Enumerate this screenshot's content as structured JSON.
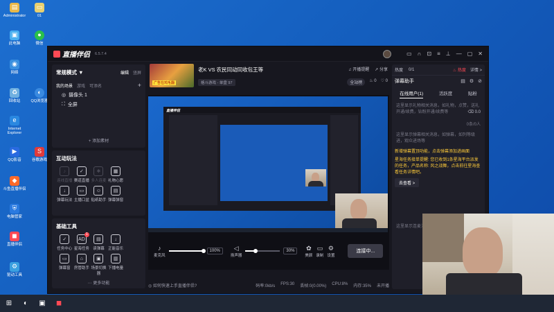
{
  "desktop": {
    "icons": [
      {
        "label": "Administrator",
        "icon": "user-folder-icon",
        "color": "#e8b84a"
      },
      {
        "label": "01",
        "icon": "folder-icon",
        "color": "#e8d070"
      },
      {
        "label": "此电脑",
        "icon": "computer-icon",
        "color": "#4ab0f0"
      },
      {
        "label": "微信",
        "icon": "wechat-icon",
        "color": "#2ac04a"
      },
      {
        "label": "网络",
        "icon": "network-icon",
        "color": "#3a90e0"
      },
      {
        "label": "回收站",
        "icon": "recycle-bin-icon",
        "color": "#70b0e0"
      },
      {
        "label": "QQ浏览器",
        "icon": "qq-browser-icon",
        "color": "#3a8ae0"
      },
      {
        "label": "Internet Explorer",
        "icon": "ie-icon",
        "color": "#2a88e0"
      },
      {
        "label": "QQ影音",
        "icon": "qq-player-icon",
        "color": "#2a6ae0"
      },
      {
        "label": "谷歌游戏",
        "icon": "game-icon",
        "color": "#e03a3a"
      },
      {
        "label": "斗鱼直播伴侣",
        "icon": "douyu-icon",
        "color": "#ff6a2a"
      },
      {
        "label": "电脑管家",
        "icon": "shield-icon",
        "color": "#2a7ae0"
      },
      {
        "label": "直播伴侣",
        "icon": "live-companion-icon",
        "color": "#ff4a55"
      },
      {
        "label": "驱动工具",
        "icon": "driver-tool-icon",
        "color": "#3aa0e0"
      }
    ]
  },
  "app": {
    "name": "直播伴侣",
    "version": "6.5.7.4",
    "titlebar_icons": [
      "chat-icon",
      "headset-icon",
      "expand-icon",
      "menu-icon",
      "pin-icon",
      "minimize-icon",
      "maximize-icon",
      "close-icon"
    ]
  },
  "scenes": {
    "mode": "常规模式 ▼",
    "edit": "编辑",
    "preset": "竖屏",
    "tabs": [
      "我的场景",
      "游戏",
      "可添名"
    ],
    "add": "+",
    "items": [
      {
        "label": "摄像头 1",
        "icon": "camera-icon"
      },
      {
        "label": "全屏",
        "icon": "fullscreen-icon"
      }
    ],
    "add_source": "+ 添加素材"
  },
  "interactive": {
    "title": "互动玩法",
    "tools": [
      {
        "label": "连线直播",
        "icon": "mic-icon",
        "disabled": true
      },
      {
        "label": "赛道直播",
        "icon": "shield-check-icon",
        "disabled": false
      },
      {
        "label": "多人连麦",
        "icon": "multi-mic-icon",
        "disabled": true
      },
      {
        "label": "礼物心愿",
        "icon": "gift-icon",
        "disabled": false
      },
      {
        "label": "",
        "icon": "",
        "disabled": false
      },
      {
        "label": "弹幕玩法",
        "icon": "download-icon",
        "disabled": false
      },
      {
        "label": "主播口盆",
        "icon": "chest-icon",
        "disabled": false
      },
      {
        "label": "贴纸助手",
        "icon": "sticker-icon",
        "disabled": false
      },
      {
        "label": "弹幕弹窗",
        "icon": "popup-icon",
        "disabled": false
      }
    ]
  },
  "basic": {
    "title": "基础工具",
    "tools": [
      {
        "label": "任务中心",
        "icon": "task-icon",
        "badge": ""
      },
      {
        "label": "星海任务",
        "icon": "ad-icon",
        "badge": "1"
      },
      {
        "label": "读弹幕",
        "icon": "read-icon",
        "badge": ""
      },
      {
        "label": "正能音乐",
        "icon": "music-download-icon",
        "badge": ""
      },
      {
        "label": "",
        "icon": "",
        "badge": ""
      },
      {
        "label": "弹幕窗",
        "icon": "danmu-window-icon",
        "badge": ""
      },
      {
        "label": "房管助手",
        "icon": "admin-icon",
        "badge": ""
      },
      {
        "label": "场景切换器",
        "icon": "switch-icon",
        "badge": ""
      },
      {
        "label": "下播电量",
        "icon": "battery-icon",
        "badge": ""
      }
    ],
    "more": "更多功能"
  },
  "room": {
    "title": "老K VS 农民同动同收包王等",
    "category": "格斗游戏 - 单盘 97",
    "cover_text": "广告在鸡毛翻",
    "notify": "开播提醒",
    "share": "分享",
    "tag": "全站榜",
    "likes": "0",
    "hearts": "0"
  },
  "controls": {
    "mic_label": "麦克风",
    "mic_value": "100%",
    "mic_level": 1.0,
    "speaker_label": "扬声器",
    "speaker_value": "30%",
    "speaker_level": 0.3,
    "beauty_label": "美颜",
    "record_label": "录制",
    "settings_label": "设置",
    "connect_label": "连接中..."
  },
  "status": {
    "help": "如何快速上手直播伴侣?",
    "bitrate": "码率:0kb/s",
    "fps": "FPS:30",
    "drop": "丢帧:0(0.00%)",
    "cpu": "CPU:8%",
    "mem": "内存:35%",
    "net": "未开播"
  },
  "right": {
    "top_left": "热度",
    "count": "0/1",
    "hot": "热度",
    "detail": "详情 >",
    "danmu_title": "弹幕助手",
    "tabs": [
      "在线用户(1)",
      "活跃度",
      "贴粉"
    ],
    "hint1": "这里显示礼物相关消息，如礼物，点赞，送礼开通/续费，钻粉开通/续费等",
    "score": "0.0",
    "ratio": "0条/0人",
    "hint2": "这里显示弹幕相关消息，如弹幕，如列等级进，观众进场等",
    "notice1": "新增弹幕置顶功能，点击弹幕添加进画面",
    "notice2": "星海任务接单提醒: 您已收到1条星海平台派发的任务，产品名称: 风之战舞，点击前往星海查看任务详情吧。",
    "go": "去查看 >",
    "hint3": "这里显示连麦消息"
  }
}
